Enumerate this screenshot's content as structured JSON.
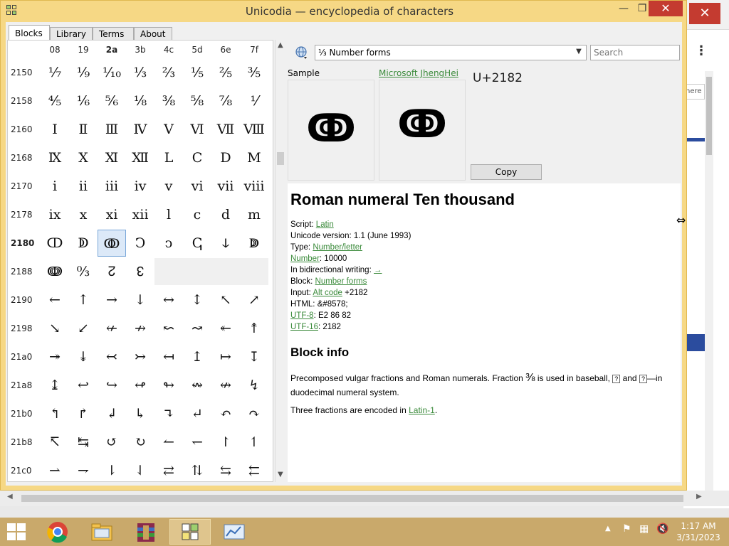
{
  "window": {
    "title": "Unicodia — encyclopedia of characters",
    "minimize_glyph": "—",
    "maximize_glyph": "❐",
    "close_glyph": "✕"
  },
  "tabs": [
    "Blocks",
    "Library",
    "Terms",
    "About"
  ],
  "grid": {
    "columns": [
      "08",
      "19",
      "2a",
      "3b",
      "4c",
      "5d",
      "6e",
      "7f"
    ],
    "bold_column_index": 2,
    "rows": [
      {
        "label": "2150",
        "cells": [
          "⅐",
          "⅑",
          "⅒",
          "⅓",
          "⅔",
          "⅕",
          "⅖",
          "⅗"
        ]
      },
      {
        "label": "2158",
        "cells": [
          "⅘",
          "⅙",
          "⅚",
          "⅛",
          "⅜",
          "⅝",
          "⅞",
          "⅟"
        ]
      },
      {
        "label": "2160",
        "cells": [
          "Ⅰ",
          "Ⅱ",
          "Ⅲ",
          "Ⅳ",
          "Ⅴ",
          "Ⅵ",
          "Ⅶ",
          "Ⅷ"
        ]
      },
      {
        "label": "2168",
        "cells": [
          "Ⅸ",
          "Ⅹ",
          "Ⅺ",
          "Ⅻ",
          "Ⅼ",
          "Ⅽ",
          "Ⅾ",
          "Ⅿ"
        ]
      },
      {
        "label": "2170",
        "cells": [
          "ⅰ",
          "ⅱ",
          "ⅲ",
          "ⅳ",
          "ⅴ",
          "ⅵ",
          "ⅶ",
          "ⅷ"
        ]
      },
      {
        "label": "2178",
        "cells": [
          "ⅸ",
          "ⅹ",
          "ⅺ",
          "ⅻ",
          "ⅼ",
          "ⅽ",
          "ⅾ",
          "ⅿ"
        ]
      },
      {
        "label": "2180",
        "cells": [
          "ↀ",
          "ↁ",
          "ↂ",
          "Ↄ",
          "ↄ",
          "ↅ",
          "ↆ",
          "ↇ"
        ]
      },
      {
        "label": "2188",
        "cells": [
          "ↈ",
          "↉",
          "↊",
          "↋",
          "",
          "",
          "",
          ""
        ]
      },
      {
        "label": "2190",
        "cells": [
          "←",
          "↑",
          "→",
          "↓",
          "↔",
          "↕",
          "↖",
          "↗"
        ]
      },
      {
        "label": "2198",
        "cells": [
          "↘",
          "↙",
          "↚",
          "↛",
          "↜",
          "↝",
          "↞",
          "↟"
        ]
      },
      {
        "label": "21a0",
        "cells": [
          "↠",
          "↡",
          "↢",
          "↣",
          "↤",
          "↥",
          "↦",
          "↧"
        ]
      },
      {
        "label": "21a8",
        "cells": [
          "↨",
          "↩",
          "↪",
          "↫",
          "↬",
          "↭",
          "↮",
          "↯"
        ]
      },
      {
        "label": "21b0",
        "cells": [
          "↰",
          "↱",
          "↲",
          "↳",
          "↴",
          "↵",
          "↶",
          "↷"
        ]
      },
      {
        "label": "21b8",
        "cells": [
          "↸",
          "↹",
          "↺",
          "↻",
          "↼",
          "↽",
          "↾",
          "↿"
        ]
      },
      {
        "label": "21c0",
        "cells": [
          "⇀",
          "⇁",
          "⇂",
          "⇃",
          "⇄",
          "⇅",
          "⇆",
          "⇇"
        ]
      }
    ],
    "selected": {
      "row": "2180",
      "col": "2a"
    }
  },
  "block_select": {
    "value": "⅓ Number forms"
  },
  "search": {
    "placeholder": "Search"
  },
  "sample": {
    "label": "Sample",
    "font_label": "Microsoft JhengHei",
    "glyph": "ↂ",
    "codepoint": "U+2182",
    "copy_label": "Copy"
  },
  "character": {
    "name": "Roman numeral Ten thousand",
    "props": [
      {
        "key": "Script: ",
        "link": "Latin",
        "rest": ""
      },
      {
        "key": "Unicode version: 1.1 (June 1993)",
        "link": "",
        "rest": ""
      },
      {
        "key": "Type: ",
        "link": "Number/letter",
        "rest": ""
      },
      {
        "key": "",
        "link": "Number",
        "rest": ": 10000"
      },
      {
        "key": "In bidirectional writing: ",
        "link": "→",
        "rest": ""
      },
      {
        "key": "Block: ",
        "link": "Number forms",
        "rest": ""
      },
      {
        "key": "Input: ",
        "link": "Alt code",
        "rest": " +2182"
      },
      {
        "key": "HTML: &#8578;",
        "link": "",
        "rest": ""
      },
      {
        "key": "",
        "link": "UTF-8",
        "rest": ": E2 86 82"
      },
      {
        "key": "",
        "link": "UTF-16",
        "rest": ": 2182"
      }
    ]
  },
  "block_info": {
    "title": "Block info",
    "desc_part1": "Precomposed vulgar fractions and Roman numerals. Fraction ",
    "desc_glyph": "⅜",
    "desc_part2": " is used in baseball, ",
    "desc_box1": "?",
    "desc_part3": " and ",
    "desc_box2": "?",
    "desc_part4": "—in duodecimal numeral system.",
    "desc2_part1": "Three fractions are encoded in ",
    "desc2_link": "Latin-1",
    "desc2_part2": "."
  },
  "background": {
    "close_glyph": "✕",
    "menu_glyph": "⋮",
    "partial_text": "here"
  },
  "taskbar": {
    "apps": [
      "chrome-app",
      "file-explorer-app",
      "winrar-app",
      "unicodia-app",
      "control-panel-app"
    ],
    "time": "1:17 AM",
    "date": "3/31/2023"
  },
  "colors": {
    "title_bar": "#f6d885",
    "taskbar": "#c9a96b",
    "link": "#3a8a3a",
    "selection": "#dce9f8",
    "close_button": "#c43b30"
  }
}
